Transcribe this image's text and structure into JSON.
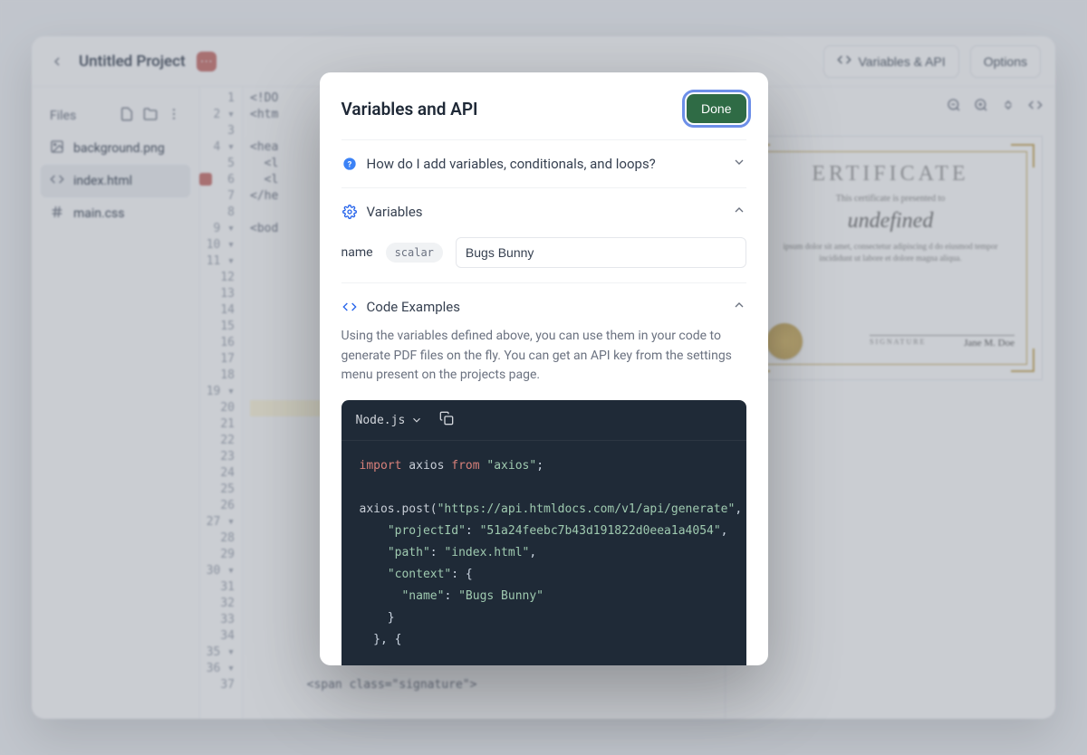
{
  "topbar": {
    "project_title": "Untitled Project",
    "variables_btn": "Variables & API",
    "options_btn": "Options"
  },
  "sidebar": {
    "header": "Files",
    "files": [
      {
        "name": "background.png",
        "icon": "image"
      },
      {
        "name": "index.html",
        "icon": "code",
        "selected": true
      },
      {
        "name": "main.css",
        "icon": "hash"
      }
    ]
  },
  "editor": {
    "lines": [
      "<!DO",
      "<htm",
      "",
      "<hea",
      "  <l",
      "  <l",
      "</he",
      "",
      "<bod",
      "",
      "",
      "",
      "",
      "",
      "",
      "",
      "",
      "",
      "",
      "",
      "",
      "",
      "",
      "",
      "",
      "",
      "",
      "",
      "",
      "",
      "",
      "",
      "",
      "",
      "",
      "",
      "        <span class=\"signature\">"
    ]
  },
  "preview": {
    "cert_title": "ERTIFICATE",
    "cert_sub": "This certificate is presented to",
    "cert_name": "undefined",
    "cert_body": "ipsum dolor sit amet, consectetur adipiscing\nd do eiusmod tempor incididunt ut labore et\ndolore magna aliqua.",
    "sig_label": "SIGNATURE",
    "sig_name": "Jane M. Doe"
  },
  "modal": {
    "title": "Variables and API",
    "done": "Done",
    "help_question": "How do I add variables, conditionals, and loops?",
    "variables_header": "Variables",
    "var_name_label": "name",
    "var_type": "scalar",
    "var_value": "Bugs Bunny",
    "code_header": "Code Examples",
    "code_desc": "Using the variables defined above, you can use them in your code to generate PDF files on the fly. You can get an API key from the settings menu present on the projects page.",
    "code_lang": "Node.js",
    "code": {
      "l1_kw": "import",
      "l1_id": " axios ",
      "l1_from": "from ",
      "l1_str": "\"axios\"",
      "l1_end": ";",
      "l3a": "axios.post(",
      "l3s": "\"https://api.htmldocs.com/v1/api/generate\"",
      "l3b": ", {",
      "l4a": "    ",
      "l4k": "\"projectId\"",
      "l4c": ": ",
      "l4v": "\"51a24feebc7b43d191822d0eea1a4054\"",
      "l4e": ",",
      "l5a": "    ",
      "l5k": "\"path\"",
      "l5c": ": ",
      "l5v": "\"index.html\"",
      "l5e": ",",
      "l6a": "    ",
      "l6k": "\"context\"",
      "l6c": ": {",
      "l7a": "      ",
      "l7k": "\"name\"",
      "l7c": ": ",
      "l7v": "\"Bugs Bunny\"",
      "l8": "    }",
      "l9": "  }, {"
    }
  }
}
